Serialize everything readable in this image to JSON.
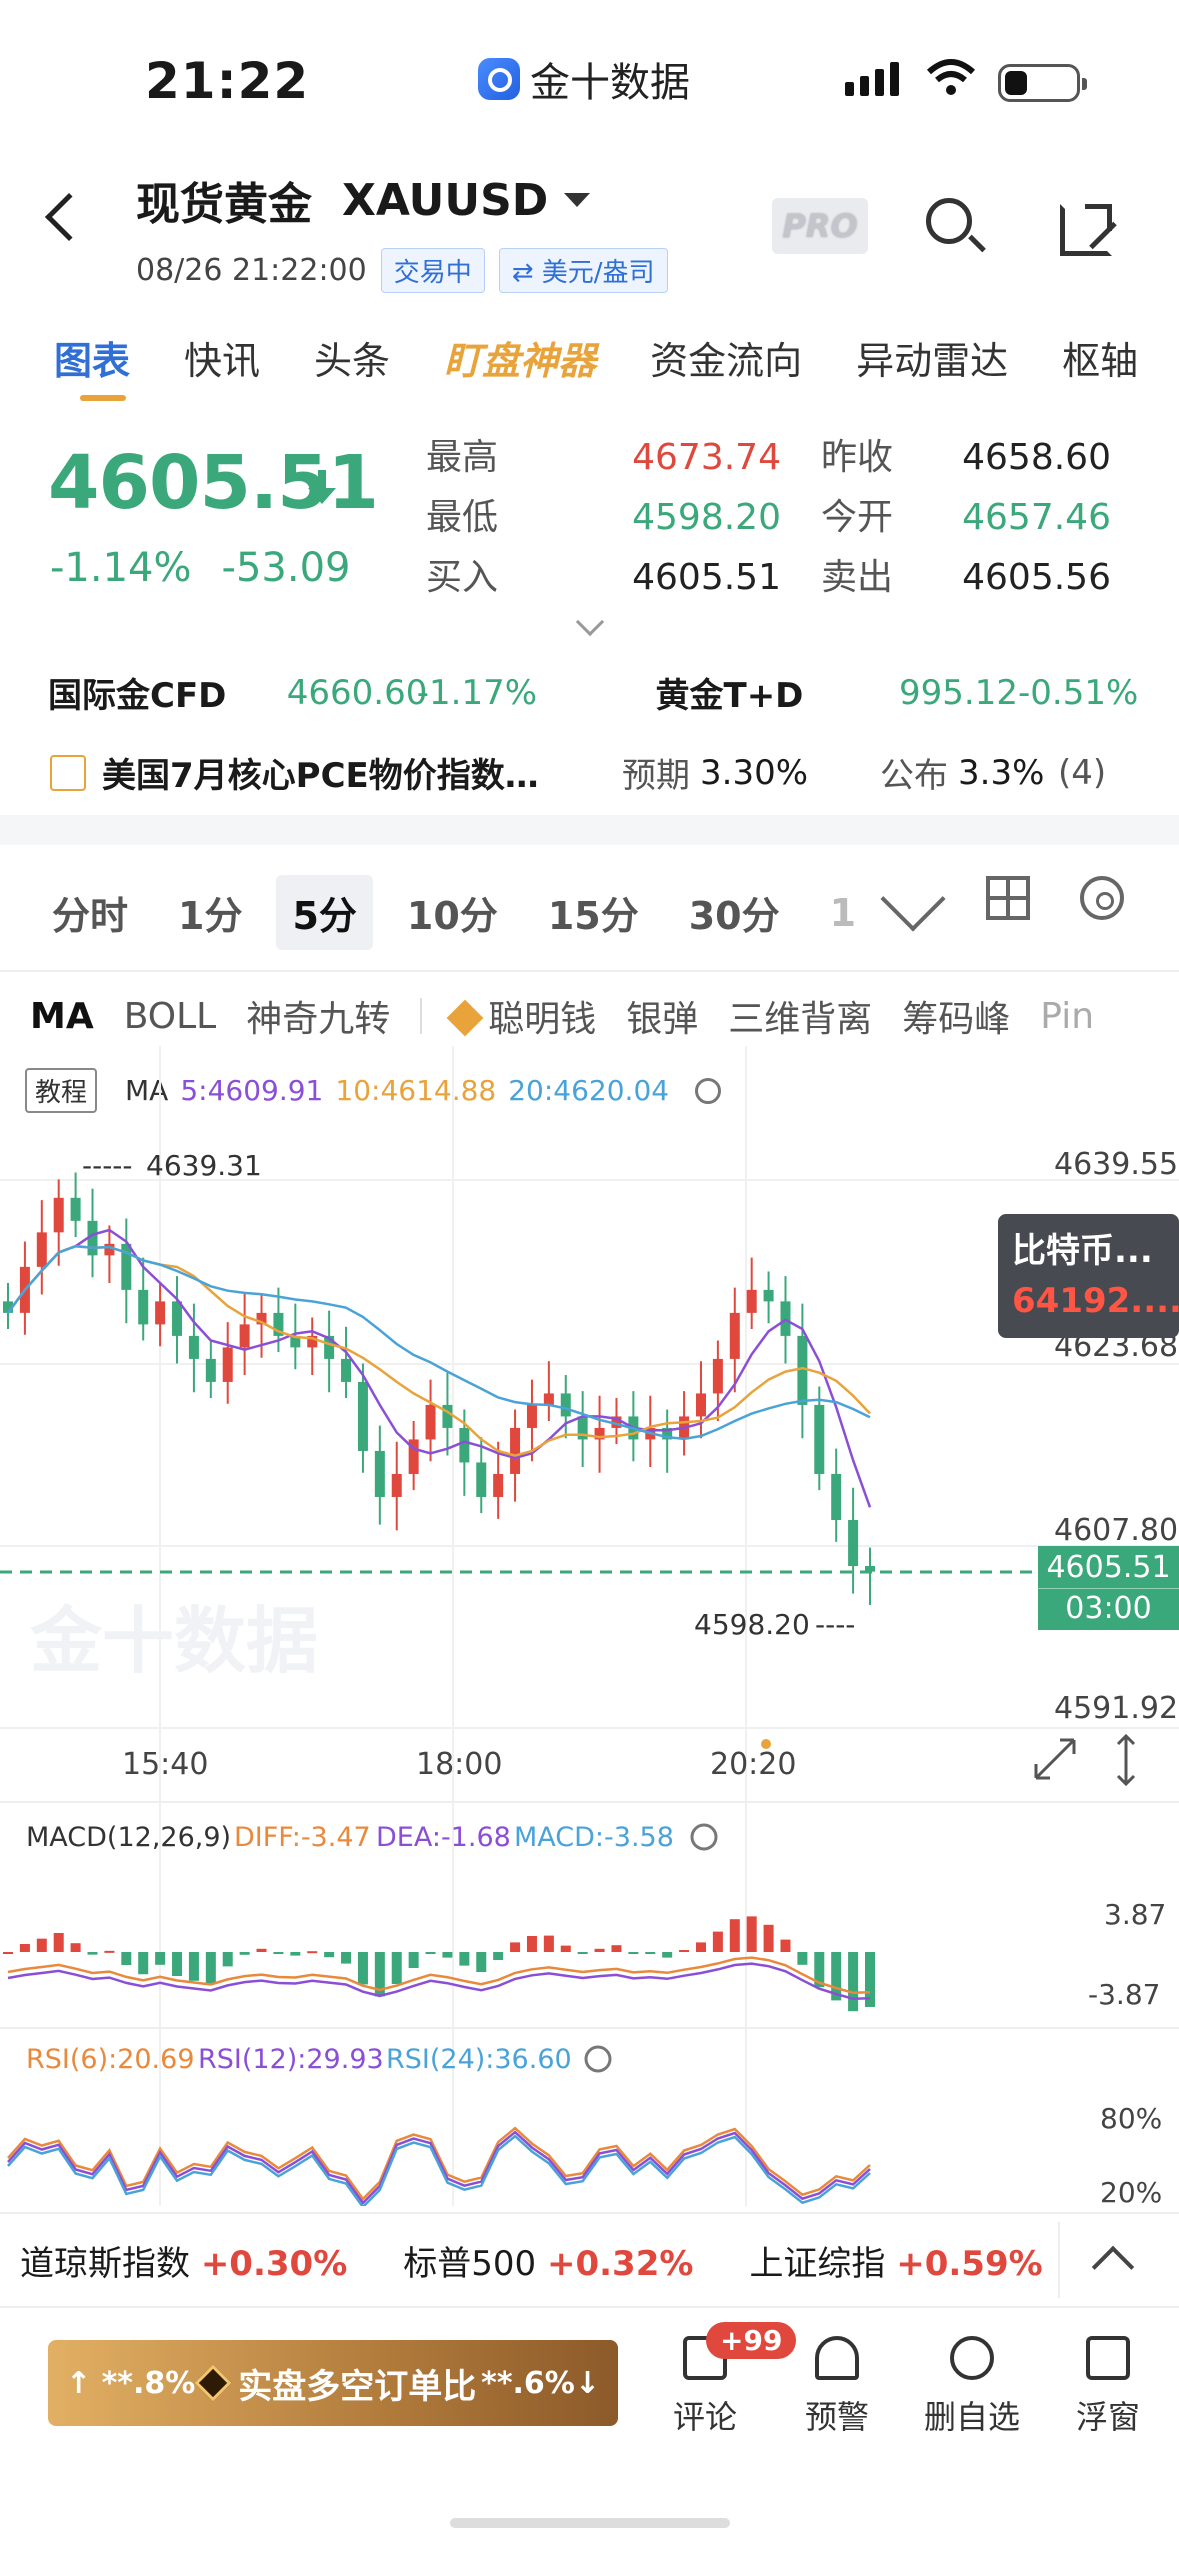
{
  "status_bar": {
    "time": "21:22",
    "app": "金十数据"
  },
  "header": {
    "title": "现货黄金",
    "code": "XAUUSD",
    "datetime": "08/26 21:22:00",
    "status": "交易中",
    "currency": "⇄ 美元/盎司",
    "pro": "PRO"
  },
  "tabs": [
    "图表",
    "快讯",
    "头条",
    "盯盘神器",
    "资金流向",
    "异动雷达",
    "枢轴"
  ],
  "quote": {
    "price": "4605.51",
    "change_pct": "-1.14%",
    "change": "-53.09",
    "high_label": "最高",
    "high": "4673.74",
    "prev_close_label": "昨收",
    "prev_close": "4658.60",
    "low_label": "最低",
    "low": "4598.20",
    "open_label": "今开",
    "open": "4657.46",
    "bid_label": "买入",
    "bid": "4605.51",
    "ask_label": "卖出",
    "ask": "4605.56"
  },
  "related": {
    "cfd_name": "国际金CFD",
    "cfd_price": "4660.60",
    "cfd_pct": "-1.17%",
    "td_name": "黄金T+D",
    "td_price": "995.12",
    "td_pct": "-0.51%"
  },
  "event": {
    "title": "美国7月核心PCE物价指数…",
    "expect_label": "预期",
    "expect": "3.30%",
    "publish_label": "公布",
    "publish": "3.3%",
    "count": "(4)"
  },
  "periods": [
    "分时",
    "1分",
    "5分",
    "10分",
    "15分",
    "30分",
    "1"
  ],
  "indicators": [
    "MA",
    "BOLL",
    "神奇九转",
    "聪明钱",
    "银弹",
    "三维背离",
    "筹码峰",
    "Pin"
  ],
  "ma_legend": {
    "edu": "教程",
    "label": "MA",
    "ma5": "5:4609.91",
    "ma10": "10:4614.88",
    "ma20": "20:4620.04"
  },
  "price_axis": [
    "4639.55",
    "4623.68",
    "4607.80",
    "4591.92"
  ],
  "annotations": {
    "high": "4639.31",
    "low": "4598.20"
  },
  "time_axis": [
    "15:40",
    "18:00",
    "20:20"
  ],
  "current_label": {
    "price": "4605.51",
    "countdown": "03:00"
  },
  "btc": {
    "name": "比特币...",
    "price": "64192...."
  },
  "watermark": "金十数据",
  "macd": {
    "label": "MACD(12,26,9)",
    "diff": "DIFF:-3.47",
    "dea": "DEA:-1.68",
    "macd": "MACD:-3.58",
    "top": "3.87",
    "bottom": "-3.87"
  },
  "rsi": {
    "r6": "RSI(6):20.69",
    "r12": "RSI(12):29.93",
    "r24": "RSI(24):36.60",
    "top": "80%",
    "bottom": "20%"
  },
  "indices": [
    {
      "name": "道琼斯指数",
      "pct": "+0.30%"
    },
    {
      "name": "标普500",
      "pct": "+0.32%"
    },
    {
      "name": "上证综指",
      "pct": "+0.59%"
    }
  ],
  "bottom": {
    "banner_left": "↑ **.8%",
    "banner_mid": "实盘多空订单比",
    "banner_right": "**.6%↓",
    "comment": "评论",
    "badge": "+99",
    "alert": "预警",
    "remove": "删自选",
    "float": "浮窗"
  },
  "colors": {
    "up": "#e0473d",
    "down": "#3aa87a",
    "accent": "#2f6fd6",
    "gold": "#e8a33b"
  },
  "chart_data": {
    "type": "candlestick",
    "interval": "5分",
    "candles_close": [
      4628,
      4632,
      4635,
      4638,
      4636,
      4633,
      4634,
      4630,
      4627,
      4629,
      4626,
      4624,
      4622,
      4625,
      4627,
      4628,
      4626,
      4625,
      4626,
      4624,
      4622,
      4616,
      4612,
      4614,
      4617,
      4620,
      4618,
      4615,
      4612,
      4614,
      4618,
      4620,
      4621,
      4619,
      4617,
      4618,
      4619,
      4617,
      4618,
      4617,
      4619,
      4621,
      4624,
      4628,
      4630,
      4629,
      4626,
      4620,
      4614,
      4610,
      4606,
      4605.51
    ],
    "ma5_last": 4609.91,
    "ma10_last": 4614.88,
    "ma20_last": 4620.04,
    "ylim": [
      4591.92,
      4639.55
    ]
  }
}
